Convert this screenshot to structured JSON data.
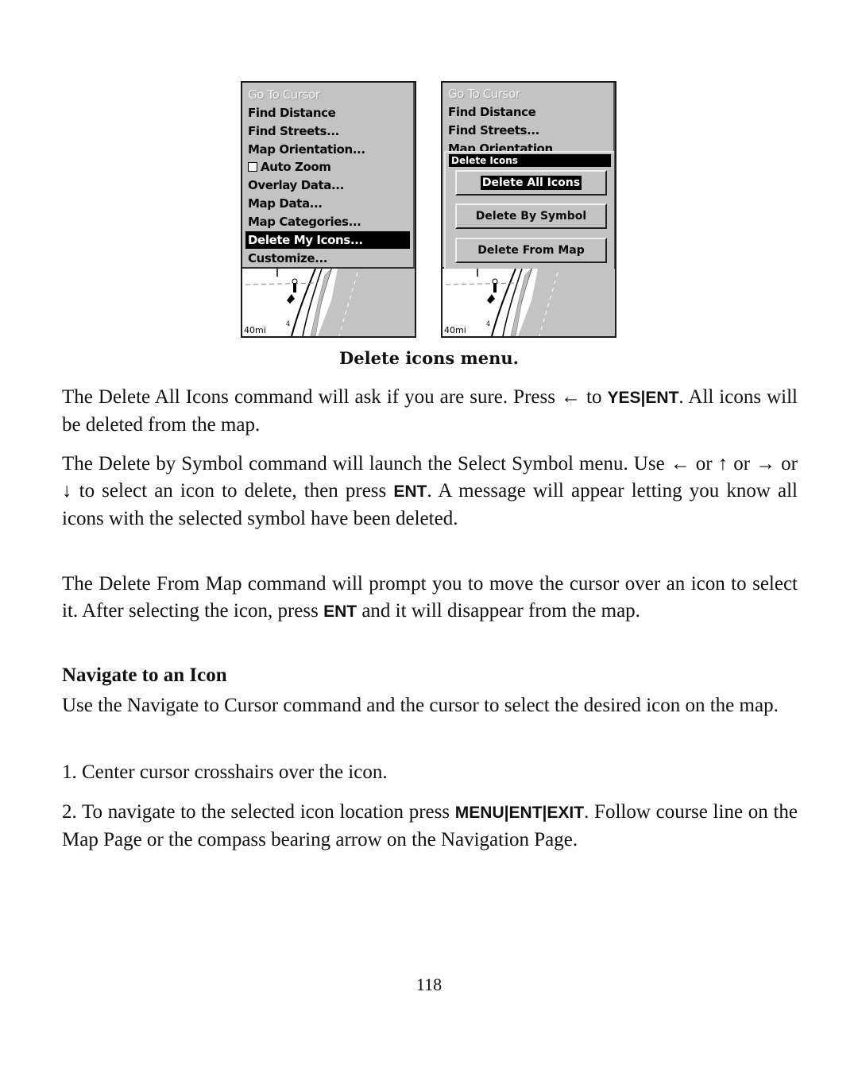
{
  "figure": {
    "left_screen": {
      "menu_items": [
        {
          "label": "Go To Cursor",
          "state": "disabled"
        },
        {
          "label": "Find Distance",
          "state": "normal"
        },
        {
          "label": "Find Streets...",
          "state": "normal"
        },
        {
          "label": "Map Orientation...",
          "state": "normal"
        },
        {
          "label": "Auto Zoom",
          "state": "checkbox-unchecked"
        },
        {
          "label": "Overlay Data...",
          "state": "normal"
        },
        {
          "label": "Map Data...",
          "state": "normal"
        },
        {
          "label": "Map Categories...",
          "state": "normal"
        },
        {
          "label": "Delete My Icons...",
          "state": "selected"
        },
        {
          "label": "Customize...",
          "state": "normal"
        }
      ],
      "map_scale": "40mi"
    },
    "right_screen": {
      "menu_items": [
        {
          "label": "Go To Cursor",
          "state": "disabled"
        },
        {
          "label": "Find Distance",
          "state": "normal"
        },
        {
          "label": "Find Streets...",
          "state": "normal"
        },
        {
          "label": "Map Orientation",
          "state": "partially-hidden"
        }
      ],
      "dialog": {
        "title": "Delete Icons",
        "buttons": [
          {
            "label": "Delete All Icons",
            "selected": true
          },
          {
            "label": "Delete By Symbol",
            "selected": false
          },
          {
            "label": "Delete From Map",
            "selected": false
          }
        ]
      },
      "map_scale": "40mi"
    },
    "caption": "Delete icons menu."
  },
  "body": {
    "p1": {
      "t1": "The Delete All Icons command will ask if you are sure. Press ",
      "arrow_left": "←",
      "t2": " to ",
      "key_yes": "YES",
      "sep": "|",
      "key_ent": "ENT",
      "t3": ". All icons will be deleted from the map."
    },
    "p2": {
      "t1": "The Delete by Symbol command will launch the Select Symbol menu. Use ",
      "arrow_left": "←",
      "or1": " or ",
      "arrow_up": "↑",
      "or2": " or ",
      "arrow_right": "→",
      "or3": " or ",
      "arrow_down": "↓",
      "t2": " to select an icon to delete, then press ",
      "key_ent": "ENT",
      "t3": ". A message will appear letting you know all icons with the selected symbol have been deleted."
    },
    "p3": {
      "t1": "The Delete From Map command will prompt you to move the cursor over an icon to select it. After selecting the icon, press ",
      "key_ent": "ENT",
      "t2": " and it will disappear from the map."
    },
    "heading": "Navigate to an Icon",
    "p4": "Use the Navigate to Cursor command and the cursor to select the desired icon on the map.",
    "step1": "1. Center cursor crosshairs over the icon.",
    "step2": {
      "t1": "2. To navigate to the selected icon location press ",
      "key_menu": "MENU",
      "sep": "|",
      "key_ent": "ENT",
      "key_exit": "EXIT",
      "t2": ". Follow course line on the Map Page or the compass bearing arrow on the Navigation Page."
    }
  },
  "page_number": "118"
}
